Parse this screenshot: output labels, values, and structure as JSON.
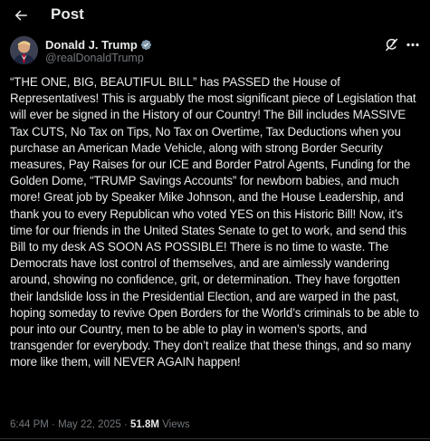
{
  "header": {
    "title": "Post",
    "back_icon": "arrow-left-icon"
  },
  "author": {
    "display_name": "Donald J. Trump",
    "handle": "@realDonaldTrump",
    "verified_icon": "verified-badge-icon",
    "verified_color": "#829aab"
  },
  "actions": {
    "grok_icon": "grok-slash-icon",
    "more_icon": "ellipsis-icon"
  },
  "post": {
    "text": "“THE ONE, BIG, BEAUTIFUL BILL” has PASSED the House of Representatives! This is arguably the most significant piece of Legislation that will ever be signed in the History of our Country! The Bill includes MASSIVE Tax CUTS, No Tax on Tips, No Tax on Overtime, Tax Deductions when you purchase an American Made Vehicle, along with strong Border Security measures, Pay Raises for our ICE and Border Patrol Agents, Funding for the Golden Dome, “TRUMP Savings Accounts” for newborn babies, and much more! Great job by Speaker Mike Johnson, and the House Leadership, and thank you to every Republican who voted YES on this Historic Bill! Now, it’s time for our friends in the United States Senate to get to work, and send this Bill to my desk AS SOON AS POSSIBLE! There is no time to waste. The Democrats have lost control of themselves, and are aimlessly wandering around, showing no confidence, grit, or determination. They have forgotten their landslide loss in the Presidential Election, and are warped in the past, hoping someday to revive Open Borders for the World’s criminals to be able to pour into our Country, men to be able to play in women’s sports, and transgender for everybody. They don’t realize that these things, and so many more like them, will NEVER AGAIN happen!",
    "time": "6:44 PM",
    "separator": "·",
    "date": "May 22, 2025",
    "views_count": "51.8M",
    "views_label": "Views"
  },
  "colors": {
    "background": "#000000",
    "text": "#e7e9ea",
    "muted": "#71767b",
    "border": "#2f3336"
  }
}
